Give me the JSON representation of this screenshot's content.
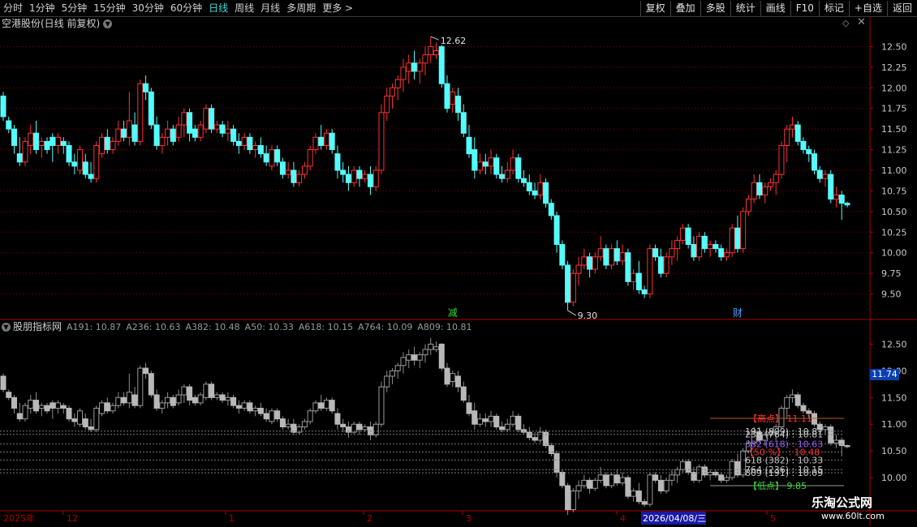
{
  "toolbar": {
    "periods": [
      {
        "label": "分时"
      },
      {
        "label": "1分钟"
      },
      {
        "label": "5分钟"
      },
      {
        "label": "15分钟"
      },
      {
        "label": "30分钟"
      },
      {
        "label": "60分钟"
      },
      {
        "label": "日线",
        "active": true
      },
      {
        "label": "周线"
      },
      {
        "label": "月线"
      },
      {
        "label": "多周期"
      },
      {
        "label": "更多 >"
      }
    ],
    "buttons": [
      {
        "label": "复权"
      },
      {
        "label": "叠加"
      },
      {
        "label": "多股"
      },
      {
        "label": "统计"
      },
      {
        "label": "画线"
      },
      {
        "label": "F10"
      },
      {
        "label": "标记"
      },
      {
        "label": "+自选"
      },
      {
        "label": "返回"
      }
    ]
  },
  "main_chart": {
    "title": "空港股份(日线 前复权)",
    "high_label": "12.62",
    "low_label": "9.30",
    "event_markers": [
      {
        "label": "减"
      },
      {
        "label": "财"
      }
    ]
  },
  "indicator": {
    "name": "股朋指标网",
    "values": [
      {
        "label": "A191: 10.87"
      },
      {
        "label": "A236: 10.63"
      },
      {
        "label": "A382: 10.48"
      },
      {
        "label": "A50: 10.33"
      },
      {
        "label": "A618: 10.15"
      },
      {
        "label": "A764: 10.09"
      },
      {
        "label": "A809: 10.81"
      }
    ],
    "price_tag": "11.74",
    "annotations": [
      {
        "label": "【高点】  11.11",
        "color": "#ff3030"
      },
      {
        "label": "191 (809) : 10.87",
        "color": "#c8c8c8"
      },
      {
        "label": "236 (764) : 10.81",
        "color": "#c8c8c8"
      },
      {
        "label": "382 (618) : 10.63",
        "color": "#9b5cff"
      },
      {
        "label": "【50 %】 : 10.48",
        "color": "#ff3030"
      },
      {
        "label": "618 (382) : 10.33",
        "color": "#c8c8c8"
      },
      {
        "label": "764 (236) : 10.15",
        "color": "#c8c8c8"
      },
      {
        "label": "809 (191) : 10.09",
        "color": "#c8c8c8"
      },
      {
        "label": "【低点】  9.85",
        "color": "#33dd33"
      }
    ]
  },
  "axis": {
    "main_ticks": [
      "12.50",
      "12.25",
      "12.00",
      "11.75",
      "11.50",
      "11.25",
      "11.00",
      "10.75",
      "10.50",
      "10.25",
      "10.00",
      "9.75",
      "9.50"
    ],
    "ind_ticks": [
      "12.50",
      "12.00",
      "11.50",
      "11.00",
      "10.50",
      "10.00"
    ],
    "date_labels": [
      {
        "label": "2025年"
      },
      {
        "label": "12"
      },
      {
        "label": "1"
      },
      {
        "label": "2"
      },
      {
        "label": "3"
      },
      {
        "label": "4"
      },
      {
        "label": "2026/04/08/三",
        "highlight": true
      },
      {
        "label": "5"
      }
    ]
  },
  "watermark": {
    "title": "乐淘公式网",
    "url": "www.60lt.com"
  },
  "colors": {
    "up": "#ff3232",
    "down": "#54fcfc",
    "grid": "#8b0000",
    "bg": "#000000"
  },
  "chart_data": {
    "type": "candlestick",
    "x": [
      1,
      2,
      3,
      4,
      5,
      6,
      7,
      8,
      9,
      10,
      11,
      12,
      13,
      14,
      15,
      16,
      17,
      18,
      19,
      20,
      21,
      22,
      23,
      24,
      25,
      26,
      27,
      28,
      29,
      30,
      31,
      32,
      33,
      34,
      35,
      36,
      37,
      38,
      39,
      40,
      41,
      42,
      43,
      44,
      45,
      46,
      47,
      48,
      49,
      50,
      51,
      52,
      53,
      54,
      55,
      56,
      57,
      58,
      59,
      60,
      61,
      62,
      63,
      64,
      65,
      66,
      67,
      68,
      69,
      70,
      71,
      72,
      73,
      74,
      75,
      76,
      77,
      78,
      79,
      80,
      81,
      82,
      83,
      84,
      85,
      86,
      87,
      88,
      89,
      90,
      91,
      92,
      93,
      94,
      95,
      96,
      97,
      98,
      99,
      100,
      101,
      102,
      103,
      104,
      105,
      106,
      107,
      108,
      109,
      110,
      111,
      112,
      113,
      114,
      115,
      116,
      117,
      118,
      119,
      120,
      121,
      122,
      123,
      124,
      125,
      126,
      127,
      128,
      129,
      130,
      131,
      132,
      133,
      134,
      135,
      136,
      137,
      138,
      139,
      140,
      141,
      142,
      143,
      144,
      145,
      146,
      147,
      148,
      149,
      150,
      151,
      152,
      153,
      154,
      155,
      156,
      157,
      158,
      159,
      160
    ],
    "ohlc": [
      [
        11.9,
        11.95,
        11.6,
        11.65
      ],
      [
        11.6,
        11.65,
        11.45,
        11.5
      ],
      [
        11.5,
        11.55,
        11.2,
        11.3
      ],
      [
        11.2,
        11.4,
        11.05,
        11.1
      ],
      [
        11.1,
        11.4,
        11.05,
        11.35
      ],
      [
        11.3,
        11.55,
        11.2,
        11.45
      ],
      [
        11.45,
        11.6,
        11.2,
        11.25
      ],
      [
        11.3,
        11.4,
        11.15,
        11.35
      ],
      [
        11.35,
        11.4,
        11.2,
        11.25
      ],
      [
        11.4,
        11.45,
        11.1,
        11.3
      ],
      [
        11.3,
        11.45,
        11.2,
        11.4
      ],
      [
        11.35,
        11.4,
        11.2,
        11.3
      ],
      [
        11.3,
        11.35,
        11.05,
        11.1
      ],
      [
        11.1,
        11.2,
        10.95,
        11.05
      ],
      [
        11.0,
        11.3,
        10.95,
        11.25
      ],
      [
        11.1,
        11.2,
        10.9,
        10.95
      ],
      [
        10.95,
        11.1,
        10.85,
        10.9
      ],
      [
        10.9,
        11.35,
        10.85,
        11.3
      ],
      [
        11.2,
        11.45,
        11.15,
        11.4
      ],
      [
        11.4,
        11.5,
        11.2,
        11.25
      ],
      [
        11.25,
        11.4,
        11.2,
        11.35
      ],
      [
        11.35,
        11.6,
        11.3,
        11.5
      ],
      [
        11.5,
        11.6,
        11.35,
        11.4
      ],
      [
        11.4,
        11.95,
        11.3,
        11.6
      ],
      [
        11.55,
        11.7,
        11.3,
        11.35
      ],
      [
        11.35,
        12.1,
        11.3,
        12.05
      ],
      [
        12.05,
        12.15,
        11.85,
        11.95
      ],
      [
        11.95,
        12.0,
        11.5,
        11.55
      ],
      [
        11.55,
        11.65,
        11.25,
        11.3
      ],
      [
        11.3,
        11.45,
        11.2,
        11.4
      ],
      [
        11.4,
        11.6,
        11.3,
        11.5
      ],
      [
        11.5,
        11.55,
        11.3,
        11.35
      ],
      [
        11.4,
        11.65,
        11.35,
        11.55
      ],
      [
        11.55,
        11.75,
        11.4,
        11.7
      ],
      [
        11.7,
        11.75,
        11.35,
        11.45
      ],
      [
        11.5,
        11.55,
        11.35,
        11.4
      ],
      [
        11.4,
        11.6,
        11.35,
        11.55
      ],
      [
        11.5,
        11.8,
        11.45,
        11.75
      ],
      [
        11.75,
        11.8,
        11.45,
        11.5
      ],
      [
        11.5,
        11.6,
        11.45,
        11.55
      ],
      [
        11.55,
        11.6,
        11.4,
        11.45
      ],
      [
        11.45,
        11.6,
        11.35,
        11.5
      ],
      [
        11.5,
        11.55,
        11.3,
        11.35
      ],
      [
        11.35,
        11.45,
        11.2,
        11.3
      ],
      [
        11.3,
        11.45,
        11.25,
        11.4
      ],
      [
        11.4,
        11.45,
        11.2,
        11.25
      ],
      [
        11.25,
        11.35,
        11.15,
        11.3
      ],
      [
        11.3,
        11.4,
        11.15,
        11.2
      ],
      [
        11.2,
        11.3,
        11.05,
        11.1
      ],
      [
        11.05,
        11.3,
        11.0,
        11.25
      ],
      [
        11.25,
        11.3,
        11.05,
        11.1
      ],
      [
        11.1,
        11.15,
        10.9,
        10.95
      ],
      [
        10.95,
        11.1,
        10.9,
        11.0
      ],
      [
        11.0,
        11.1,
        10.8,
        10.85
      ],
      [
        10.85,
        11.0,
        10.8,
        10.95
      ],
      [
        10.95,
        11.1,
        10.9,
        11.05
      ],
      [
        11.05,
        11.3,
        11.0,
        11.25
      ],
      [
        11.25,
        11.45,
        11.2,
        11.4
      ],
      [
        11.4,
        11.55,
        11.25,
        11.3
      ],
      [
        11.3,
        11.5,
        11.25,
        11.45
      ],
      [
        11.45,
        11.5,
        11.2,
        11.25
      ],
      [
        11.2,
        11.3,
        10.9,
        11.0
      ],
      [
        11.0,
        11.1,
        10.85,
        10.95
      ],
      [
        10.95,
        11.05,
        10.75,
        10.85
      ],
      [
        10.85,
        11.05,
        10.8,
        11.0
      ],
      [
        11.0,
        11.05,
        10.8,
        10.9
      ],
      [
        10.9,
        11.0,
        10.85,
        10.95
      ],
      [
        10.95,
        11.05,
        10.7,
        10.8
      ],
      [
        10.8,
        11.05,
        10.75,
        11.0
      ],
      [
        11.0,
        11.8,
        10.95,
        11.7
      ],
      [
        11.7,
        12.0,
        11.6,
        11.9
      ],
      [
        11.9,
        12.05,
        11.75,
        12.0
      ],
      [
        12.0,
        12.15,
        11.85,
        12.1
      ],
      [
        12.1,
        12.35,
        11.95,
        12.25
      ],
      [
        12.2,
        12.4,
        12.05,
        12.3
      ],
      [
        12.3,
        12.45,
        12.1,
        12.2
      ],
      [
        12.2,
        12.35,
        12.05,
        12.3
      ],
      [
        12.3,
        12.5,
        12.15,
        12.4
      ],
      [
        12.4,
        12.62,
        12.3,
        12.5
      ],
      [
        12.4,
        12.55,
        12.35,
        12.45
      ],
      [
        12.5,
        12.52,
        12.0,
        12.05
      ],
      [
        12.05,
        12.15,
        11.7,
        11.75
      ],
      [
        11.8,
        12.0,
        11.7,
        11.95
      ],
      [
        11.9,
        12.0,
        11.6,
        11.7
      ],
      [
        11.7,
        11.8,
        11.4,
        11.45
      ],
      [
        11.4,
        11.55,
        11.15,
        11.2
      ],
      [
        11.25,
        11.4,
        10.9,
        11.0
      ],
      [
        11.0,
        11.2,
        10.95,
        11.1
      ],
      [
        11.1,
        11.2,
        10.95,
        11.05
      ],
      [
        11.05,
        11.25,
        10.95,
        11.15
      ],
      [
        11.15,
        11.2,
        10.9,
        10.95
      ],
      [
        10.95,
        11.05,
        10.85,
        10.9
      ],
      [
        10.9,
        11.1,
        10.85,
        11.0
      ],
      [
        11.0,
        11.25,
        10.95,
        11.15
      ],
      [
        11.15,
        11.2,
        10.85,
        10.9
      ],
      [
        10.9,
        11.0,
        10.8,
        10.85
      ],
      [
        10.85,
        10.95,
        10.7,
        10.75
      ],
      [
        10.75,
        10.85,
        10.65,
        10.7
      ],
      [
        10.7,
        10.95,
        10.65,
        10.85
      ],
      [
        10.85,
        10.9,
        10.55,
        10.6
      ],
      [
        10.6,
        10.65,
        10.4,
        10.45
      ],
      [
        10.45,
        10.5,
        10.0,
        10.1
      ],
      [
        10.1,
        10.15,
        9.8,
        9.85
      ],
      [
        9.85,
        9.9,
        9.3,
        9.4
      ],
      [
        9.4,
        9.8,
        9.35,
        9.75
      ],
      [
        9.75,
        9.95,
        9.6,
        9.85
      ],
      [
        9.85,
        10.05,
        9.8,
        9.95
      ],
      [
        9.95,
        10.0,
        9.7,
        9.8
      ],
      [
        9.8,
        10.0,
        9.75,
        9.95
      ],
      [
        9.95,
        10.2,
        9.9,
        10.05
      ],
      [
        10.05,
        10.1,
        9.8,
        9.85
      ],
      [
        9.85,
        10.1,
        9.8,
        10.05
      ],
      [
        10.05,
        10.15,
        9.85,
        9.9
      ],
      [
        9.9,
        10.1,
        9.85,
        10.0
      ],
      [
        10.0,
        10.05,
        9.6,
        9.65
      ],
      [
        9.65,
        9.8,
        9.55,
        9.75
      ],
      [
        9.75,
        9.9,
        9.5,
        9.55
      ],
      [
        9.55,
        9.6,
        9.45,
        9.5
      ],
      [
        9.5,
        10.1,
        9.45,
        10.05
      ],
      [
        10.05,
        10.1,
        9.9,
        9.95
      ],
      [
        9.95,
        10.05,
        9.7,
        9.75
      ],
      [
        9.75,
        10.0,
        9.7,
        9.95
      ],
      [
        9.95,
        10.15,
        9.85,
        10.05
      ],
      [
        10.05,
        10.2,
        9.9,
        10.15
      ],
      [
        10.15,
        10.35,
        10.1,
        10.3
      ],
      [
        10.3,
        10.35,
        10.05,
        10.1
      ],
      [
        10.1,
        10.2,
        9.9,
        9.95
      ],
      [
        9.95,
        10.25,
        9.9,
        10.2
      ],
      [
        10.2,
        10.25,
        10.0,
        10.05
      ],
      [
        10.05,
        10.15,
        9.95,
        10.1
      ],
      [
        10.1,
        10.15,
        10.0,
        10.05
      ],
      [
        10.05,
        10.1,
        9.9,
        9.95
      ],
      [
        9.95,
        10.05,
        9.9,
        10.0
      ],
      [
        10.0,
        10.35,
        9.95,
        10.3
      ],
      [
        10.3,
        10.45,
        10.0,
        10.05
      ],
      [
        10.05,
        10.55,
        10.0,
        10.5
      ],
      [
        10.5,
        10.7,
        10.45,
        10.65
      ],
      [
        10.65,
        10.95,
        10.6,
        10.85
      ],
      [
        10.85,
        10.95,
        10.65,
        10.7
      ],
      [
        10.7,
        10.85,
        10.6,
        10.8
      ],
      [
        10.8,
        10.9,
        10.75,
        10.85
      ],
      [
        10.85,
        11.0,
        10.7,
        10.95
      ],
      [
        10.95,
        11.35,
        10.9,
        11.3
      ],
      [
        11.3,
        11.55,
        11.1,
        11.5
      ],
      [
        11.5,
        11.65,
        11.4,
        11.55
      ],
      [
        11.55,
        11.6,
        11.3,
        11.35
      ],
      [
        11.35,
        11.4,
        11.2,
        11.25
      ],
      [
        11.25,
        11.3,
        11.1,
        11.2
      ],
      [
        11.2,
        11.25,
        10.95,
        11.0
      ],
      [
        11.0,
        11.05,
        10.85,
        10.9
      ],
      [
        10.9,
        11.0,
        10.8,
        10.95
      ],
      [
        10.95,
        11.0,
        10.6,
        10.65
      ],
      [
        10.65,
        10.8,
        10.55,
        10.7
      ],
      [
        10.7,
        10.75,
        10.4,
        10.6
      ],
      [
        10.6,
        10.62,
        10.55,
        10.58
      ]
    ],
    "main_ylim": [
      9.25,
      12.75
    ],
    "ind_ylim": [
      9.5,
      12.75
    ],
    "ind_levels": [
      11.11,
      10.87,
      10.81,
      10.63,
      10.48,
      10.33,
      10.15,
      10.09,
      9.85
    ]
  }
}
